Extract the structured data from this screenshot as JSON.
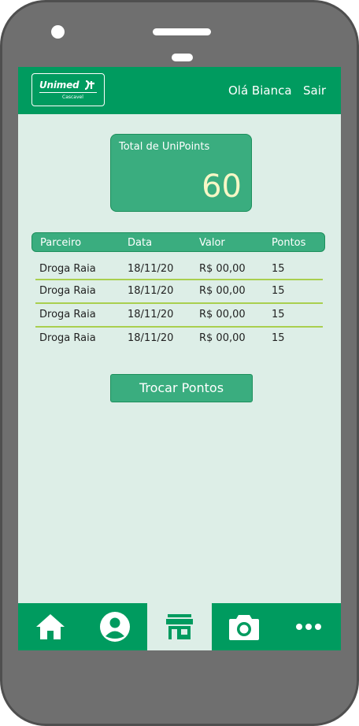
{
  "header": {
    "brand": "Unimed",
    "brand_sub": "Cascavel",
    "greeting": "Olá Bianca",
    "logout": "Sair"
  },
  "points": {
    "label": "Total de UniPoints",
    "value": "60"
  },
  "table": {
    "columns": [
      "Parceiro",
      "Data",
      "Valor",
      "Pontos"
    ],
    "rows": [
      [
        "Droga Raia",
        "18/11/20",
        "R$ 00,00",
        "15"
      ],
      [
        "Droga Raia",
        "18/11/20",
        "R$ 00,00",
        "15"
      ],
      [
        "Droga Raia",
        "18/11/20",
        "R$ 00,00",
        "15"
      ],
      [
        "Droga Raia",
        "18/11/20",
        "R$ 00,00",
        "15"
      ]
    ]
  },
  "actions": {
    "exchange": "Trocar Pontos"
  },
  "nav": {
    "items": [
      "home-icon",
      "user-icon",
      "store-icon",
      "camera-icon",
      "more-icon"
    ],
    "active": "store-icon"
  },
  "colors": {
    "primary": "#009b5f",
    "card": "#3aad7f",
    "background": "#ddeee7",
    "separator": "#a9cf4f",
    "points_value": "#f7f7c6"
  }
}
